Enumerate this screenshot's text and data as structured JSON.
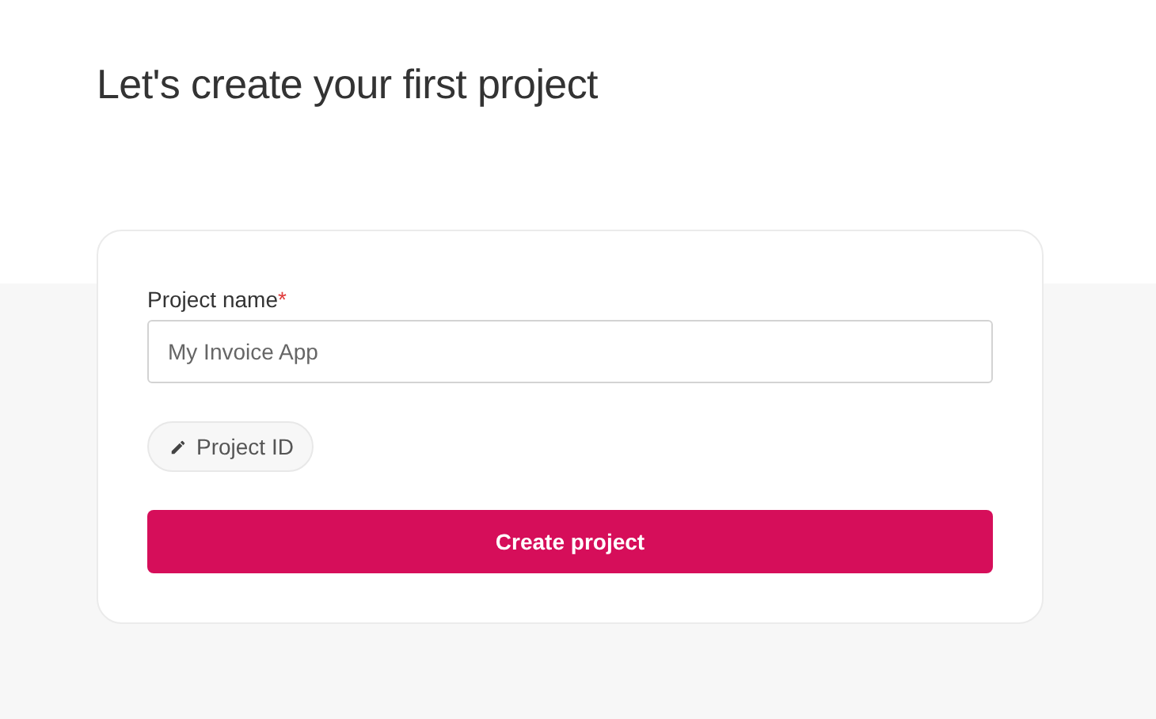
{
  "heading": "Let's create your first project",
  "form": {
    "name_field": {
      "label": "Project name",
      "required_mark": "*",
      "placeholder": "My Invoice App"
    },
    "project_id_button": {
      "label": "Project ID"
    },
    "submit_button": {
      "label": "Create project"
    }
  }
}
